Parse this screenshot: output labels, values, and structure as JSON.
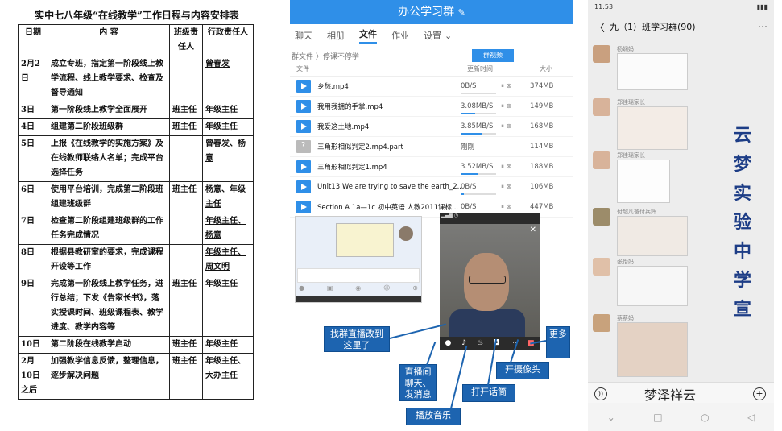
{
  "schedule": {
    "title": "实中七八年级“在线教学”工作日程与内容安排表",
    "headers": [
      "日期",
      "内    容",
      "班级责任人",
      "行政责任人"
    ],
    "rows": [
      [
        "2月2日",
        "成立专班，指定第一阶段线上教学流程、线上教学要求、检查及督导通知",
        "",
        "曾春发"
      ],
      [
        "3日",
        "第一阶段线上教学全面展开",
        "班主任",
        "年级主任"
      ],
      [
        "4日",
        "组建第二阶段班级群",
        "班主任",
        "年级主任"
      ],
      [
        "5日",
        "上报《在线教学的实施方案》及在线教师联络人名单；完成平台选择任务",
        "",
        "曾春发、杨意"
      ],
      [
        "6日",
        "使用平台培训，完成第二阶段班组建班级群",
        "班主任",
        "杨意、年级主任"
      ],
      [
        "7日",
        "检查第二阶段组建班级群的工作任务完成情况",
        "",
        "年级主任、杨意"
      ],
      [
        "8日",
        "根据县教研室的要求，完成课程开设等工作",
        "",
        "年级主任、周文明"
      ],
      [
        "9日",
        "完成第一阶段线上教学任务，进行总结；下发《告家长书》，落实授课时间、班级课程表、教学进度、教学内容等",
        "班主任",
        "年级主任"
      ],
      [
        "10日",
        "第二阶段在线教学启动",
        "班主任",
        "年级主任"
      ],
      [
        "2月10日之后",
        "加强教学信息反馈，整理信息，逐步解决问题",
        "班主任",
        "年级主任、大办主任"
      ]
    ]
  },
  "filesapp": {
    "header_title": "办公学习群",
    "tabs": [
      "聊天",
      "相册",
      "文件",
      "作业",
      "设置"
    ],
    "active_tab": "文件",
    "breadcrumb": "群文件 〉停课不停学",
    "group_button": "群视频",
    "col_file": "文件",
    "col_time": "更新时间",
    "col_size": "大小",
    "files": [
      {
        "name": "乡愁.mp4",
        "speed": "0B/S",
        "progress": 0.0,
        "size": "374MB",
        "icon": "play-icon"
      },
      {
        "name": "我用我拥的手掌.mp4",
        "speed": "3.08MB/S",
        "progress": 0.4,
        "size": "149MB",
        "icon": "play-icon"
      },
      {
        "name": "我爱这土地.mp4",
        "speed": "3.85MB/S",
        "progress": 0.6,
        "size": "168MB",
        "icon": "play-icon"
      },
      {
        "name": "三角形相似判定2.mp4.part",
        "speed": "刚刚",
        "progress": 0.0,
        "size": "114MB",
        "icon": "unknown-file-icon"
      },
      {
        "name": "三角形相似判定1.mp4",
        "speed": "3.52MB/S",
        "progress": 0.5,
        "size": "188MB",
        "icon": "play-icon"
      },
      {
        "name": "Unit13 We are trying to save the earth_2...",
        "speed": "0B/S",
        "progress": 0.1,
        "size": "106MB",
        "icon": "play-icon"
      },
      {
        "name": "Section A 1a—1c 初中英语 人教2011课标...",
        "speed": "0B/S",
        "progress": 0.05,
        "size": "447MB",
        "icon": "play-icon"
      }
    ],
    "callouts": {
      "group_live": "找群直播改到这里了",
      "chat_msg": "直播间聊天、发消息",
      "play_music": "播放音乐",
      "open_mic": "打开话筒",
      "open_camera": "开摄像头",
      "more": "更多"
    }
  },
  "phone": {
    "status_time": "11:53",
    "title": "九（1）班学习群(90)",
    "messages": [
      {
        "name": "杨娴妈"
      },
      {
        "name": "郑佳瑶家长"
      },
      {
        "name": "郑佳瑶家长"
      },
      {
        "name": "付超凡爸付兵辉"
      },
      {
        "name": "张怡妈"
      },
      {
        "name": "蔡蔡妈"
      }
    ],
    "vertical_text": "云梦实验中学宣",
    "watermark": "梦泽祥云"
  }
}
